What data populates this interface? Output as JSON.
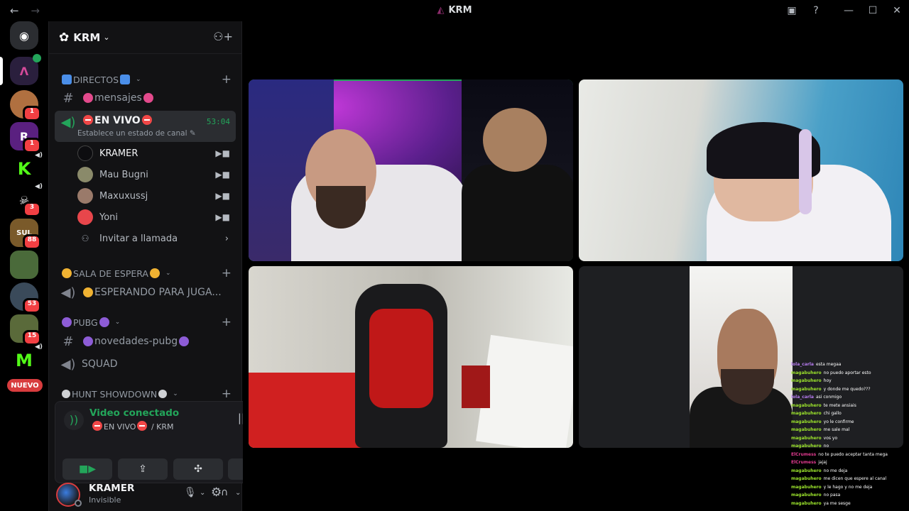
{
  "window": {
    "title": "KRM",
    "back": "←",
    "forward": "→",
    "inbox_icon": "inbox-icon",
    "help_icon": "help-icon",
    "min": "—",
    "max": "☐",
    "close": "✕"
  },
  "guilds": {
    "badges": [
      "1",
      "1",
      "3",
      "88",
      "53",
      "15"
    ],
    "nuevo": "NUEVO"
  },
  "server": {
    "name": "KRM"
  },
  "categories": {
    "directos": "DIRECTOS",
    "sala": "SALA DE ESPERA",
    "pubg": "PUBG",
    "hunt": "HUNT SHOWDOWN"
  },
  "channels": {
    "mensajes": "mensajes",
    "en_vivo": "EN VIVO",
    "en_vivo_status": "Establece un estado de canal",
    "timer": "53:04",
    "esperando": "ESPERANDO PARA JUGA...",
    "novedades": "novedades-pubg",
    "squad": "SQUAD"
  },
  "members": [
    {
      "name": "KRAMER"
    },
    {
      "name": "Mau Bugni"
    },
    {
      "name": "Maxuxussj"
    },
    {
      "name": "Yoni"
    }
  ],
  "invite_label": "Invitar a llamada",
  "voice": {
    "status": "Video conectado",
    "location_channel": "EN VIVO",
    "location_server": "/ KRM"
  },
  "user": {
    "name": "KRAMER",
    "status": "Invisible"
  },
  "chat_lines": [
    {
      "user": "lola_carla",
      "text": "esta megaa",
      "c": "pu"
    },
    {
      "user": "magabuhero",
      "text": "no puedo aportar esto",
      "c": ""
    },
    {
      "user": "magabuhero",
      "text": "hoy",
      "c": ""
    },
    {
      "user": "magabuhero",
      "text": "y donde me quedo???",
      "c": ""
    },
    {
      "user": "lola_carla",
      "text": "asi conmigo",
      "c": "pu"
    },
    {
      "user": "magabuhero",
      "text": "te mete ansiais",
      "c": ""
    },
    {
      "user": "magabuhero",
      "text": "chi gallo",
      "c": ""
    },
    {
      "user": "magabuhero",
      "text": "yo le confirme",
      "c": ""
    },
    {
      "user": "magabuhero",
      "text": "me sale mal",
      "c": ""
    },
    {
      "user": "magabuhero",
      "text": "vos yo",
      "c": ""
    },
    {
      "user": "magabuhero",
      "text": "no",
      "c": ""
    },
    {
      "user": "ElCrumess",
      "text": "no te puedo aceptar tanta mega",
      "c": "pk"
    },
    {
      "user": "ElCrumess",
      "text": "jajaj",
      "c": "pk"
    },
    {
      "user": "magabuhero",
      "text": "no me deja",
      "c": ""
    },
    {
      "user": "magabuhero",
      "text": "me dicen que espere al canal",
      "c": ""
    },
    {
      "user": "magabuhero",
      "text": "y le hago y no me deja",
      "c": ""
    },
    {
      "user": "magabuhero",
      "text": "no pasa",
      "c": ""
    },
    {
      "user": "magabuhero",
      "text": "ya me sesge",
      "c": ""
    }
  ]
}
